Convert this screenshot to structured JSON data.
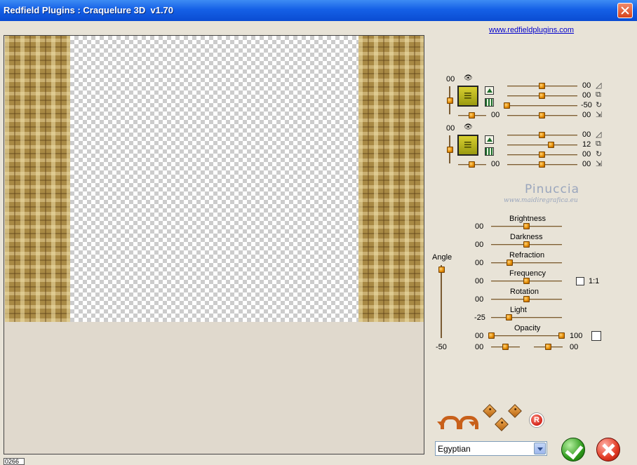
{
  "window": {
    "title": "Redfield Plugins : Craquelure 3D  v1.70"
  },
  "website_link": "www.redfieldplugins.com",
  "status_text": "0266",
  "layer1": {
    "left_value": "00",
    "bottom_value": "00",
    "sliders": [
      {
        "value": "00",
        "icon": "triangle-icon"
      },
      {
        "value": "00",
        "icon": "squares-icon"
      },
      {
        "value": "-50",
        "icon": "rotate-icon"
      },
      {
        "value": "00",
        "icon": "shift-icon"
      }
    ]
  },
  "layer2": {
    "left_value": "00",
    "bottom_value": "00",
    "sliders": [
      {
        "value": "00",
        "icon": "triangle-icon"
      },
      {
        "value": "12",
        "icon": "squares-icon"
      },
      {
        "value": "00",
        "icon": "rotate-icon"
      },
      {
        "value": "00",
        "icon": "shift-icon"
      }
    ]
  },
  "watermark": {
    "name": "Pinuccia",
    "url": "www.maidiregrafica.eu"
  },
  "angle": {
    "label": "Angle",
    "value": "-50"
  },
  "params": [
    {
      "label": "Brightness",
      "value": "00"
    },
    {
      "label": "Darkness",
      "value": "00"
    },
    {
      "label": "Refraction",
      "value": "00"
    },
    {
      "label": "Frequency",
      "value": "00"
    },
    {
      "label": "Rotation",
      "value": "00"
    },
    {
      "label": "Light",
      "value": "-25"
    },
    {
      "label": "Opacity",
      "value": "00",
      "right_value": "100"
    }
  ],
  "frequency_checkbox_label": "1:1",
  "bottom_sliders": {
    "left_value": "00",
    "right_value": "00"
  },
  "preset": {
    "selected": "Egyptian"
  },
  "colors": {
    "titlebar": "#0a4cd2",
    "slider_thumb": "#e28a00",
    "ok": "#2f9a1c",
    "cancel": "#e23a23"
  }
}
